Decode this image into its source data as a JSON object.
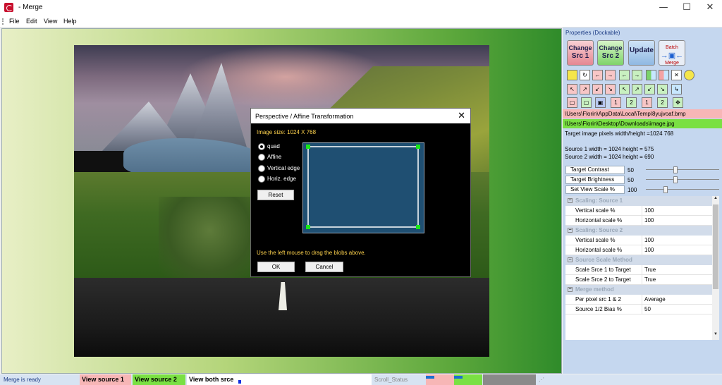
{
  "window": {
    "title": "- Merge",
    "minimize": "—",
    "maximize": "☐",
    "close": "✕"
  },
  "menu": {
    "file": "File",
    "edit": "Edit",
    "view": "View",
    "help": "Help"
  },
  "dialog": {
    "title": "Perspective / Affine Transformation",
    "close": "✕",
    "image_size": "Image size: 1024 X 768",
    "options": [
      "quad",
      "Affine",
      "Vertical edge",
      "Horiz. edge"
    ],
    "selected_option": "quad",
    "reset": "Reset",
    "hint": "Use the left mouse to drag the blobs above.",
    "ok": "OK",
    "cancel": "Cancel"
  },
  "properties": {
    "header": "Properties (Dockable)",
    "buttons": {
      "change_src1_a": "Change",
      "change_src1_b": "Src 1",
      "change_src2_a": "Change",
      "change_src2_b": "Src 2",
      "update": "Update",
      "batch_a": "Batch",
      "batch_b": "Merge"
    },
    "toolbar_row3": {
      "one_a": "1",
      "two_a": "2",
      "one_b": "1",
      "two_b": "2"
    },
    "path1": "\\Users\\Florin\\AppData\\Local\\Temp\\8yujvoaf.bmp",
    "path2": "\\Users\\Florin\\Desktop\\Downloads\\image.jpg",
    "target_size": "Target image pixels width/height =1024  768",
    "source1": "Source 1 width = 1024  height = 575",
    "source2": "Source 2 width = 1024  height = 690",
    "sliders": [
      {
        "label": "Target Contrast",
        "value": "50",
        "level": 0.4
      },
      {
        "label": "Target Brightness",
        "value": "50",
        "level": 0.4
      },
      {
        "label": "Set View Scale %",
        "value": "100",
        "level": 0.25
      }
    ],
    "grid": {
      "cat1": "Scaling: Source 1",
      "c1_r1_key": "Vertical scale %",
      "c1_r1_val": "100",
      "c1_r2_key": "Horizontal scale %",
      "c1_r2_val": "100",
      "cat2": "Scaling: Source 2",
      "c2_r1_key": "Vertical scale %",
      "c2_r1_val": "100",
      "c2_r2_key": "Horizontal scale %",
      "c2_r2_val": "100",
      "cat3": "Source Scale Method",
      "c3_r1_key": "Scale Srce 1 to Target",
      "c3_r1_val": "True",
      "c3_r2_key": "Scale Srce 2 to Target",
      "c3_r2_val": "True",
      "cat4": "Merge method",
      "c4_r1_key": "Per pixel src 1 & 2",
      "c4_r1_val": "Average",
      "c4_r2_key": "Source 1/2 Bias %",
      "c4_r2_val": "50",
      "toggle": "−"
    }
  },
  "status": {
    "ready": "Merge is ready",
    "view1": "View source 1",
    "view2": "View source 2",
    "both": "View both srce",
    "scroll": "Scroll_Status"
  },
  "colors": {
    "path1_bg": "#f7b6b6",
    "path2_bg": "#7ae043",
    "view1_bg": "#f7b6b6",
    "view2_bg": "#7ae043",
    "accent": "#1c3b84"
  }
}
